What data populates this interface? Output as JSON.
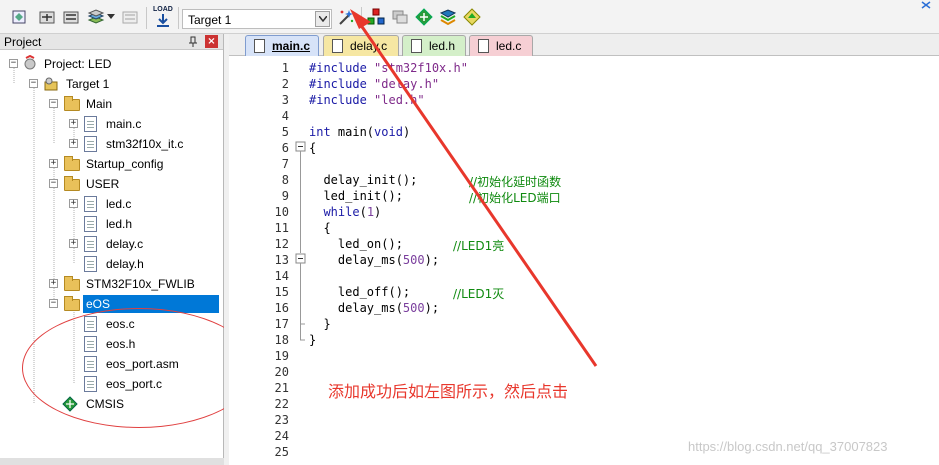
{
  "toolbar": {
    "target_value": "Target 1",
    "buttons": [
      "translate-icon",
      "build-icon",
      "rebuild-icon",
      "batch-build-icon",
      "stop-build-icon",
      "load-icon",
      "options-for-target-icon",
      "manage-components-icon",
      "select-packs-icon",
      "pack-installer-icon",
      "run-time-environment-icon",
      "manage-project-items-icon"
    ],
    "load_label": "LOAD"
  },
  "project_panel": {
    "title": "Project",
    "tree": [
      {
        "id": "project",
        "label": "Project: LED"
      },
      {
        "id": "target1",
        "label": "Target 1"
      },
      {
        "id": "main_group",
        "label": "Main"
      },
      {
        "id": "main_c",
        "label": "main.c"
      },
      {
        "id": "stm32_it",
        "label": "stm32f10x_it.c"
      },
      {
        "id": "startup",
        "label": "Startup_config"
      },
      {
        "id": "user",
        "label": "USER"
      },
      {
        "id": "led_c",
        "label": "led.c"
      },
      {
        "id": "led_h",
        "label": "led.h"
      },
      {
        "id": "delay_c",
        "label": "delay.c"
      },
      {
        "id": "delay_h",
        "label": "delay.h"
      },
      {
        "id": "fwlib",
        "label": "STM32F10x_FWLIB"
      },
      {
        "id": "eos",
        "label": "eOS"
      },
      {
        "id": "eos_c",
        "label": "eos.c"
      },
      {
        "id": "eos_h",
        "label": "eos.h"
      },
      {
        "id": "eos_port_asm",
        "label": "eos_port.asm"
      },
      {
        "id": "eos_port_c",
        "label": "eos_port.c"
      },
      {
        "id": "cmsis",
        "label": "CMSIS"
      }
    ]
  },
  "editor": {
    "tabs": [
      {
        "label": "main.c",
        "color": "#d7e3f8",
        "active": true
      },
      {
        "label": "delay.c",
        "color": "#f6e7a3",
        "active": false
      },
      {
        "label": "led.h",
        "color": "#d4efc9",
        "active": false
      },
      {
        "label": "led.c",
        "color": "#f6cfd4",
        "active": false
      }
    ],
    "line_numbers": [
      "1",
      "2",
      "3",
      "4",
      "5",
      "6",
      "7",
      "8",
      "9",
      "10",
      "11",
      "12",
      "13",
      "14",
      "15",
      "16",
      "17",
      "18",
      "19",
      "20",
      "21",
      "22",
      "23",
      "24",
      "25"
    ],
    "lines": {
      "l1": {
        "pp": "#include ",
        "str": "\"stm32f10x.h\""
      },
      "l2": {
        "pp": "#include ",
        "str": "\"delay.h\""
      },
      "l3": {
        "pp": "#include ",
        "str": "\"led.h\""
      },
      "l5": {
        "kw1": "int",
        "rest1": " main(",
        "kw2": "void",
        "rest2": ")"
      },
      "l6": {
        "text": "{"
      },
      "l8": {
        "code": "  delay_init();",
        "cmt": "//初始化延时函数"
      },
      "l9": {
        "code": "  led_init();",
        "cmt": "//初始化LED端口"
      },
      "l10": {
        "kw": "while",
        "pre": "(",
        "num": "1",
        "post": ")"
      },
      "l11": {
        "text": "  {"
      },
      "l12": {
        "code": "    led_on();",
        "cmt": "//LED1亮"
      },
      "l13": {
        "pre": "    delay_ms(",
        "num": "500",
        "post": ");"
      },
      "l15": {
        "code": "    led_off();",
        "cmt": "//LED1灭"
      },
      "l16": {
        "pre": "    delay_ms(",
        "num": "500",
        "post": ");"
      },
      "l17": {
        "text": "  }"
      },
      "l18": {
        "text": "}"
      }
    }
  },
  "annotation": "添加成功后如左图所示，然后点击",
  "watermark": "https://blog.csdn.net/qq_37007823",
  "colors": {
    "annotation_red": "#e8372c",
    "selection_blue": "#0078d7"
  }
}
